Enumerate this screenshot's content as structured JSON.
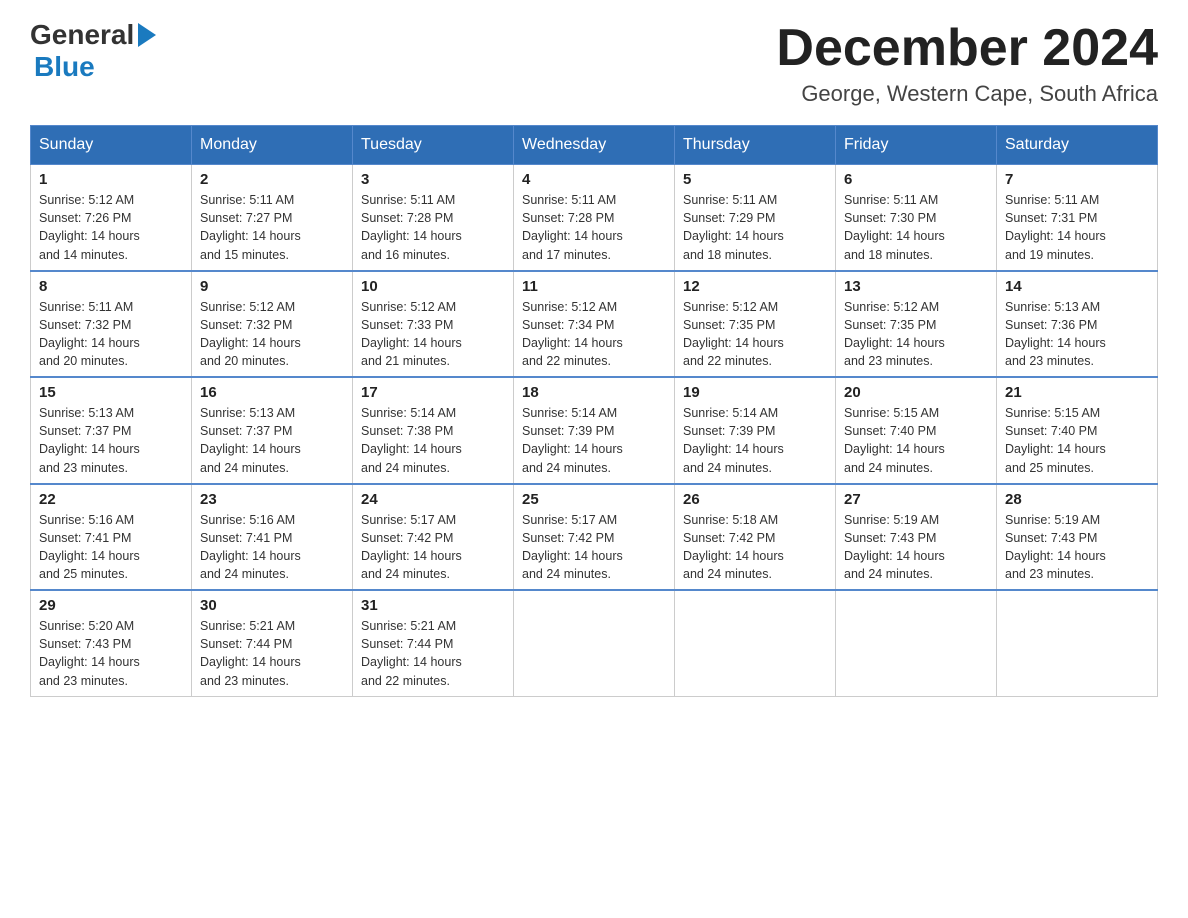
{
  "header": {
    "logo_general": "General",
    "logo_blue": "Blue",
    "title": "December 2024",
    "subtitle": "George, Western Cape, South Africa"
  },
  "days_of_week": [
    "Sunday",
    "Monday",
    "Tuesday",
    "Wednesday",
    "Thursday",
    "Friday",
    "Saturday"
  ],
  "weeks": [
    [
      {
        "num": "1",
        "sunrise": "5:12 AM",
        "sunset": "7:26 PM",
        "daylight": "14 hours and 14 minutes."
      },
      {
        "num": "2",
        "sunrise": "5:11 AM",
        "sunset": "7:27 PM",
        "daylight": "14 hours and 15 minutes."
      },
      {
        "num": "3",
        "sunrise": "5:11 AM",
        "sunset": "7:28 PM",
        "daylight": "14 hours and 16 minutes."
      },
      {
        "num": "4",
        "sunrise": "5:11 AM",
        "sunset": "7:28 PM",
        "daylight": "14 hours and 17 minutes."
      },
      {
        "num": "5",
        "sunrise": "5:11 AM",
        "sunset": "7:29 PM",
        "daylight": "14 hours and 18 minutes."
      },
      {
        "num": "6",
        "sunrise": "5:11 AM",
        "sunset": "7:30 PM",
        "daylight": "14 hours and 18 minutes."
      },
      {
        "num": "7",
        "sunrise": "5:11 AM",
        "sunset": "7:31 PM",
        "daylight": "14 hours and 19 minutes."
      }
    ],
    [
      {
        "num": "8",
        "sunrise": "5:11 AM",
        "sunset": "7:32 PM",
        "daylight": "14 hours and 20 minutes."
      },
      {
        "num": "9",
        "sunrise": "5:12 AM",
        "sunset": "7:32 PM",
        "daylight": "14 hours and 20 minutes."
      },
      {
        "num": "10",
        "sunrise": "5:12 AM",
        "sunset": "7:33 PM",
        "daylight": "14 hours and 21 minutes."
      },
      {
        "num": "11",
        "sunrise": "5:12 AM",
        "sunset": "7:34 PM",
        "daylight": "14 hours and 22 minutes."
      },
      {
        "num": "12",
        "sunrise": "5:12 AM",
        "sunset": "7:35 PM",
        "daylight": "14 hours and 22 minutes."
      },
      {
        "num": "13",
        "sunrise": "5:12 AM",
        "sunset": "7:35 PM",
        "daylight": "14 hours and 23 minutes."
      },
      {
        "num": "14",
        "sunrise": "5:13 AM",
        "sunset": "7:36 PM",
        "daylight": "14 hours and 23 minutes."
      }
    ],
    [
      {
        "num": "15",
        "sunrise": "5:13 AM",
        "sunset": "7:37 PM",
        "daylight": "14 hours and 23 minutes."
      },
      {
        "num": "16",
        "sunrise": "5:13 AM",
        "sunset": "7:37 PM",
        "daylight": "14 hours and 24 minutes."
      },
      {
        "num": "17",
        "sunrise": "5:14 AM",
        "sunset": "7:38 PM",
        "daylight": "14 hours and 24 minutes."
      },
      {
        "num": "18",
        "sunrise": "5:14 AM",
        "sunset": "7:39 PM",
        "daylight": "14 hours and 24 minutes."
      },
      {
        "num": "19",
        "sunrise": "5:14 AM",
        "sunset": "7:39 PM",
        "daylight": "14 hours and 24 minutes."
      },
      {
        "num": "20",
        "sunrise": "5:15 AM",
        "sunset": "7:40 PM",
        "daylight": "14 hours and 24 minutes."
      },
      {
        "num": "21",
        "sunrise": "5:15 AM",
        "sunset": "7:40 PM",
        "daylight": "14 hours and 25 minutes."
      }
    ],
    [
      {
        "num": "22",
        "sunrise": "5:16 AM",
        "sunset": "7:41 PM",
        "daylight": "14 hours and 25 minutes."
      },
      {
        "num": "23",
        "sunrise": "5:16 AM",
        "sunset": "7:41 PM",
        "daylight": "14 hours and 24 minutes."
      },
      {
        "num": "24",
        "sunrise": "5:17 AM",
        "sunset": "7:42 PM",
        "daylight": "14 hours and 24 minutes."
      },
      {
        "num": "25",
        "sunrise": "5:17 AM",
        "sunset": "7:42 PM",
        "daylight": "14 hours and 24 minutes."
      },
      {
        "num": "26",
        "sunrise": "5:18 AM",
        "sunset": "7:42 PM",
        "daylight": "14 hours and 24 minutes."
      },
      {
        "num": "27",
        "sunrise": "5:19 AM",
        "sunset": "7:43 PM",
        "daylight": "14 hours and 24 minutes."
      },
      {
        "num": "28",
        "sunrise": "5:19 AM",
        "sunset": "7:43 PM",
        "daylight": "14 hours and 23 minutes."
      }
    ],
    [
      {
        "num": "29",
        "sunrise": "5:20 AM",
        "sunset": "7:43 PM",
        "daylight": "14 hours and 23 minutes."
      },
      {
        "num": "30",
        "sunrise": "5:21 AM",
        "sunset": "7:44 PM",
        "daylight": "14 hours and 23 minutes."
      },
      {
        "num": "31",
        "sunrise": "5:21 AM",
        "sunset": "7:44 PM",
        "daylight": "14 hours and 22 minutes."
      },
      null,
      null,
      null,
      null
    ]
  ],
  "labels": {
    "sunrise": "Sunrise:",
    "sunset": "Sunset:",
    "daylight": "Daylight:"
  }
}
